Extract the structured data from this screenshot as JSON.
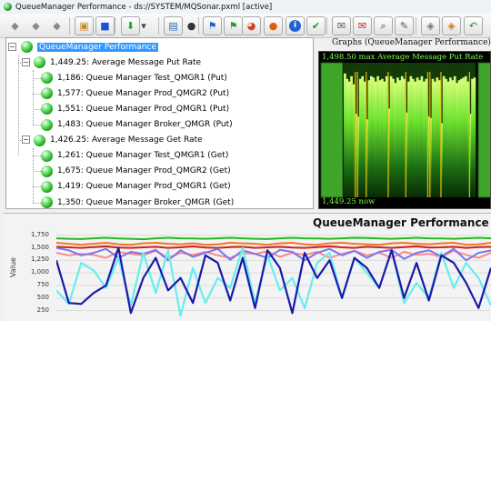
{
  "window": {
    "title": "QueueManager Performance - ds://SYSTEM/MQSonar.pxml [active]"
  },
  "toolbar": {
    "buttons": [
      {
        "icon": "cube-gray-icon"
      },
      {
        "icon": "cube-gray-icon"
      },
      {
        "icon": "cube-gray-icon"
      },
      {
        "icon": "package-icon"
      },
      {
        "icon": "stop-icon"
      },
      {
        "icon": "down-arrow-icon"
      },
      {
        "icon": "dropdown-icon"
      },
      {
        "icon": "clipboard-icon"
      },
      {
        "icon": "camera-icon"
      },
      {
        "icon": "flag-icon"
      },
      {
        "icon": "flag-drop-icon"
      },
      {
        "icon": "pie-icon"
      },
      {
        "icon": "record-icon"
      },
      {
        "icon": "info-icon"
      },
      {
        "icon": "checkmark-icon"
      },
      {
        "icon": "message-icon"
      },
      {
        "icon": "message-close-icon"
      },
      {
        "icon": "search-icon"
      },
      {
        "icon": "tools-icon"
      },
      {
        "icon": "tag-icon"
      },
      {
        "icon": "tag-alt-icon"
      },
      {
        "icon": "undo-icon"
      }
    ]
  },
  "tree": {
    "root": "QueueManager Performance",
    "groups": [
      {
        "label": "1,449.25: Average Message Put Rate",
        "children": [
          "1,186: Queue Manager Test_QMGR1 (Put)",
          "1,577: Queue Manager Prod_QMGR2 (Put)",
          "1,551: Queue Manager Prod_QMGR1 (Put)",
          "1,483: Queue Manager Broker_QMGR (Put)"
        ]
      },
      {
        "label": "1,426.25: Average Message Get Rate",
        "children": [
          "1,261: Queue Manager Test_QMGR1 (Get)",
          "1,675: Queue Manager Prod_QMGR2 (Get)",
          "1,419: Queue Manager Prod_QMGR1 (Get)",
          "1,350: Queue Manager Broker_QMGR (Get)"
        ]
      }
    ]
  },
  "graphs_panel": {
    "title": "Graphs (QueueManager Performance)",
    "max_text": "1,498.50 max Average Message Put Rate",
    "now_text": "1,449.25 now",
    "bar_levels": [
      0.92,
      0.88,
      0.86,
      0.9,
      0.84,
      0.62,
      0.6,
      0.88,
      0.9,
      0.86,
      0.58,
      0.87,
      0.9,
      0.89,
      0.86,
      0.9,
      0.87,
      0.88,
      0.86,
      0.9,
      0.66,
      0.9,
      0.88,
      0.85,
      0.89,
      0.87,
      0.9,
      0.88,
      0.63,
      0.86,
      0.9,
      0.88,
      0.86,
      0.89,
      0.87,
      0.9,
      0.86,
      0.88,
      0.6,
      0.59,
      0.88,
      0.86,
      0.89,
      0.87,
      0.55,
      0.9,
      0.88,
      0.86,
      0.89,
      0.87,
      0.9,
      0.85,
      0.87,
      0.88,
      0.89,
      0.9,
      0.86,
      0.62,
      0.88,
      0.89
    ]
  },
  "chart_data": {
    "type": "line",
    "title": "QueueManager Performance",
    "ylabel": "Value",
    "yticks": [
      "1,750",
      "1,500",
      "1,250",
      "1,000",
      "750",
      "500",
      "250"
    ],
    "ylim": [
      60,
      1800
    ],
    "grid": true,
    "series": [
      {
        "color": "#22bb22",
        "values": [
          1690,
          1680,
          1675,
          1690,
          1700,
          1685,
          1680,
          1672,
          1690,
          1700,
          1690,
          1685,
          1680,
          1690,
          1700,
          1690,
          1680,
          1675,
          1690,
          1700,
          1690,
          1685,
          1680,
          1690,
          1700,
          1695,
          1685,
          1680,
          1690,
          1700,
          1690,
          1685,
          1680,
          1690,
          1700,
          1690
        ]
      },
      {
        "color": "#cc2222",
        "values": [
          1520,
          1510,
          1500,
          1515,
          1530,
          1505,
          1500,
          1510,
          1520,
          1500,
          1510,
          1530,
          1505,
          1500,
          1515,
          1520,
          1500,
          1510,
          1520,
          1505,
          1500,
          1515,
          1530,
          1510,
          1500,
          1520,
          1510,
          1500,
          1515,
          1530,
          1505,
          1510,
          1520,
          1500,
          1515,
          1520
        ]
      },
      {
        "color": "#ee7722",
        "values": [
          1600,
          1580,
          1560,
          1580,
          1600,
          1570,
          1560,
          1590,
          1600,
          1580,
          1570,
          1590,
          1560,
          1570,
          1600,
          1590,
          1580,
          1560,
          1590,
          1600,
          1570,
          1560,
          1590,
          1600,
          1580,
          1570,
          1560,
          1590,
          1600,
          1580,
          1570,
          1590,
          1600,
          1560,
          1570,
          1600
        ]
      },
      {
        "color": "#ff8888",
        "values": [
          1400,
          1350,
          1380,
          1360,
          1300,
          1420,
          1380,
          1350,
          1440,
          1300,
          1400,
          1360,
          1420,
          1350,
          1300,
          1400,
          1380,
          1430,
          1320,
          1400,
          1360,
          1420,
          1300,
          1380,
          1440,
          1350,
          1400,
          1300,
          1420,
          1360,
          1380,
          1320,
          1440,
          1360,
          1300,
          1400
        ]
      },
      {
        "color": "#7777ee",
        "values": [
          1500,
          1450,
          1350,
          1400,
          1480,
          1300,
          1420,
          1380,
          1460,
          1250,
          1450,
          1320,
          1400,
          1480,
          1260,
          1450,
          1380,
          1300,
          1460,
          1420,
          1250,
          1400,
          1480,
          1350,
          1440,
          1300,
          1420,
          1460,
          1280,
          1400,
          1450,
          1330,
          1480,
          1250,
          1400,
          1450
        ]
      },
      {
        "color": "#66eeee",
        "values": [
          650,
          380,
          1200,
          1050,
          700,
          1300,
          350,
          1400,
          600,
          1450,
          150,
          1100,
          400,
          900,
          700,
          1500,
          400,
          1350,
          650,
          900,
          300,
          1200,
          1400,
          500,
          1300,
          1000,
          700,
          1450,
          400,
          800,
          500,
          1400,
          700,
          1200,
          900,
          350
        ]
      },
      {
        "color": "#1a1aaa",
        "values": [
          1250,
          400,
          380,
          600,
          750,
          1500,
          200,
          900,
          1300,
          650,
          900,
          400,
          1350,
          1200,
          450,
          1300,
          300,
          1450,
          1100,
          200,
          1400,
          900,
          1250,
          500,
          1300,
          1100,
          700,
          1450,
          500,
          1200,
          450,
          1350,
          1200,
          800,
          300,
          1100
        ]
      }
    ]
  }
}
